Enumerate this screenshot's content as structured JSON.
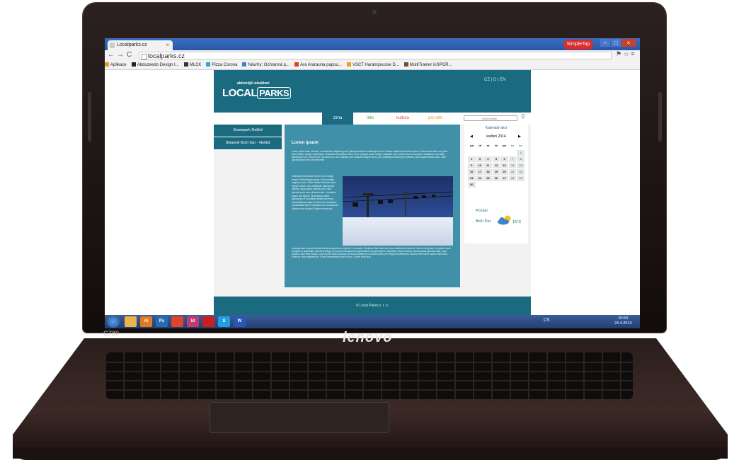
{
  "laptop": {
    "model": "G780",
    "brand": "lenovo"
  },
  "browser": {
    "tab_title": "Localparks.cz",
    "tab_close": "×",
    "url": "localparks.cz",
    "badge": "SimpleTap",
    "bookmarks": [
      {
        "label": "Aplikace",
        "color": "#e0a020"
      },
      {
        "label": "Abduzeedo Design I...",
        "color": "#222222"
      },
      {
        "label": "MLCK",
        "color": "#333333"
      },
      {
        "label": "Pizza Corona",
        "color": "#3aa0d8"
      },
      {
        "label": "Návrhy: Ochranná p...",
        "color": "#4a7bd0"
      },
      {
        "label": "Ara Ararauna papou...",
        "color": "#e04020"
      },
      {
        "label": "VSCT Harampousse D...",
        "color": "#e8a020"
      },
      {
        "label": "MultiTrainer inSPOR...",
        "color": "#7a4a2a"
      }
    ]
  },
  "site": {
    "logo_tagline": "aktivnější odvážení",
    "logo_text_a": "LOCAL",
    "logo_text_b": "PARKS",
    "languages": "CZ | D | EN",
    "menu": [
      {
        "label": "zima",
        "color": "#ffffff",
        "bg": "#1a6a80"
      },
      {
        "label": "léto",
        "color": "#3aa23a",
        "bg": "#ffffff"
      },
      {
        "label": "kultura",
        "color": "#e04a4a",
        "bg": "#ffffff"
      },
      {
        "label": "pro děti",
        "color": "#e8a020",
        "bg": "#ffffff"
      }
    ],
    "search_placeholder": "vyhledávání",
    "sidebar": [
      "Snowpark Neklid",
      "Skiareál Boží Dar - Neklid"
    ],
    "article": {
      "title": "Lorem ipsum",
      "p1": "Lorem ipsum dolor sit amet, consectetuer adipiscing elit. Quisque tincidunt scelerisque libero. Nullam dapibus fermentum ipsum. Duis viverra diam non justo. Nunc auctor. Integer malesuada. Vestibulum fermentum tortor id mi. Quisque porta. Integer vulputate sem a nibh rutrum consequat. Vestibulum erat nulla, ullamcorper nec, rutrum non, nonummy ac, erat. Aliquam erat volutpat. Integer rutrum, orci vestibulum ullamcorper ultricies, lacus quam ultricies odio, vitae placerat pede sem sit amet enim.",
      "p2": "Vestibulum fermentum tortor id mi. Integer tempor. Pellentesque ipsum. Sed convallis magna eu sem. Etiam dictum tincidunt diam. Integer rutrum, orci vestibulum ullamcorper ultricies, lacus quam ultricies odio, vitae placerat pede sem sit amet enim. In dapibus augue non sapien. Temporibus autem quibusdam et aut officiis debitis aut rerum necessitatibus saepe eveniet ut et voluptates repudiandae sint et molestiae non recusandae. Aliquam erat volutpat. Nullam rutrum nisl.",
      "p3": "consequuntur aut perferendis doloribus asperiores repellat. In convallis. Curabitur vitae diam non enim vestibulum interdum. Nemo enim ipsam voluptatem quia voluptas sit aspernatur aut odit aut fugit, sed quia consequuntur magni dolores eos qui ratione voluptatem sequi nesciunt. Donec iaculis gravida nulla. Nunc tincidunt ante vitae massa. Class aptent taciti sociosqu ad litora torquent per conubia nostra, per inceptos hymenaeos. Mauris elementum mauris vitae tortor. Vivamus luctus egestas leo. Fusce consectetuer risus a nunc. Donec vitae arcu."
    },
    "calendar": {
      "title": "Kalendář akcí",
      "month": "květen 2014",
      "prev": "◀",
      "next": "▶",
      "dow": [
        "po",
        "út",
        "st",
        "čt",
        "pá",
        "so",
        "ne"
      ],
      "days": [
        "",
        "",
        "",
        "",
        "",
        "",
        "1",
        "2",
        "3",
        "4",
        "5",
        "6",
        "7",
        "8",
        "9",
        "10",
        "11",
        "12",
        "13",
        "14",
        "15",
        "16",
        "17",
        "18",
        "19",
        "20",
        "21",
        "22",
        "23",
        "24",
        "25",
        "26",
        "27",
        "28",
        "29",
        "30"
      ]
    },
    "weather": {
      "title": "Počasí",
      "place": "Boží Dar",
      "temp": "16°C"
    },
    "footer": "© Local Parks s. r. o."
  },
  "taskbar": {
    "apps": [
      {
        "label": "",
        "color": "#e9b44a"
      },
      {
        "label": "Ai",
        "color": "#e07a20"
      },
      {
        "label": "Ps",
        "color": "#2b6ab2"
      },
      {
        "label": "",
        "color": "#e0442a"
      },
      {
        "label": "Id",
        "color": "#c23a72"
      },
      {
        "label": "",
        "color": "#c82020"
      },
      {
        "label": "S",
        "color": "#1da1e0"
      },
      {
        "label": "W",
        "color": "#2b56b2"
      }
    ],
    "lang": "CS",
    "time": "20:53",
    "date": "24.4.2014"
  }
}
